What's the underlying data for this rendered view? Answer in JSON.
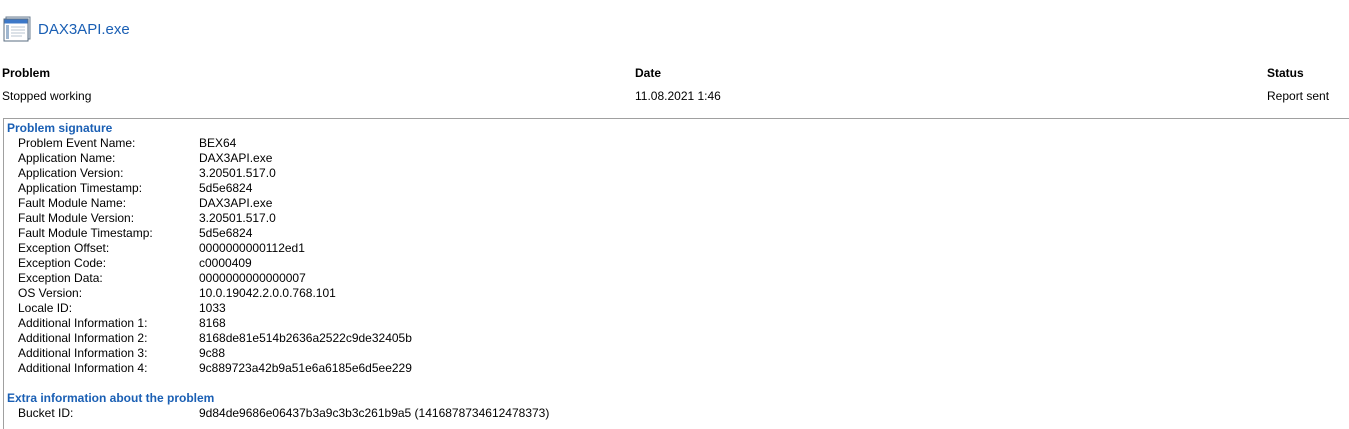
{
  "app": {
    "title": "DAX3API.exe",
    "icon": "application-window-icon"
  },
  "columns": {
    "problem_header": "Problem",
    "date_header": "Date",
    "status_header": "Status"
  },
  "report": {
    "problem": "Stopped working",
    "date": "11.08.2021 1:46",
    "status": "Report sent"
  },
  "signature": {
    "title": "Problem signature",
    "rows": [
      {
        "label": "Problem Event Name:",
        "value": "BEX64"
      },
      {
        "label": "Application Name:",
        "value": "DAX3API.exe"
      },
      {
        "label": "Application Version:",
        "value": "3.20501.517.0"
      },
      {
        "label": "Application Timestamp:",
        "value": "5d5e6824"
      },
      {
        "label": "Fault Module Name:",
        "value": "DAX3API.exe"
      },
      {
        "label": "Fault Module Version:",
        "value": "3.20501.517.0"
      },
      {
        "label": "Fault Module Timestamp:",
        "value": "5d5e6824"
      },
      {
        "label": "Exception Offset:",
        "value": "0000000000112ed1"
      },
      {
        "label": "Exception Code:",
        "value": "c0000409"
      },
      {
        "label": "Exception Data:",
        "value": "0000000000000007"
      },
      {
        "label": "OS Version:",
        "value": "10.0.19042.2.0.0.768.101"
      },
      {
        "label": "Locale ID:",
        "value": "1033"
      },
      {
        "label": "Additional Information 1:",
        "value": "8168"
      },
      {
        "label": "Additional Information 2:",
        "value": "8168de81e514b2636a2522c9de32405b"
      },
      {
        "label": "Additional Information 3:",
        "value": "9c88"
      },
      {
        "label": "Additional Information 4:",
        "value": "9c889723a42b9a51e6a6185e6d5ee229"
      }
    ]
  },
  "extra": {
    "title": "Extra information about the problem",
    "rows": [
      {
        "label": "Bucket ID:",
        "value": "9d84de9686e06437b3a9c3b3c261b9a5 (1416878734612478373)"
      }
    ]
  }
}
